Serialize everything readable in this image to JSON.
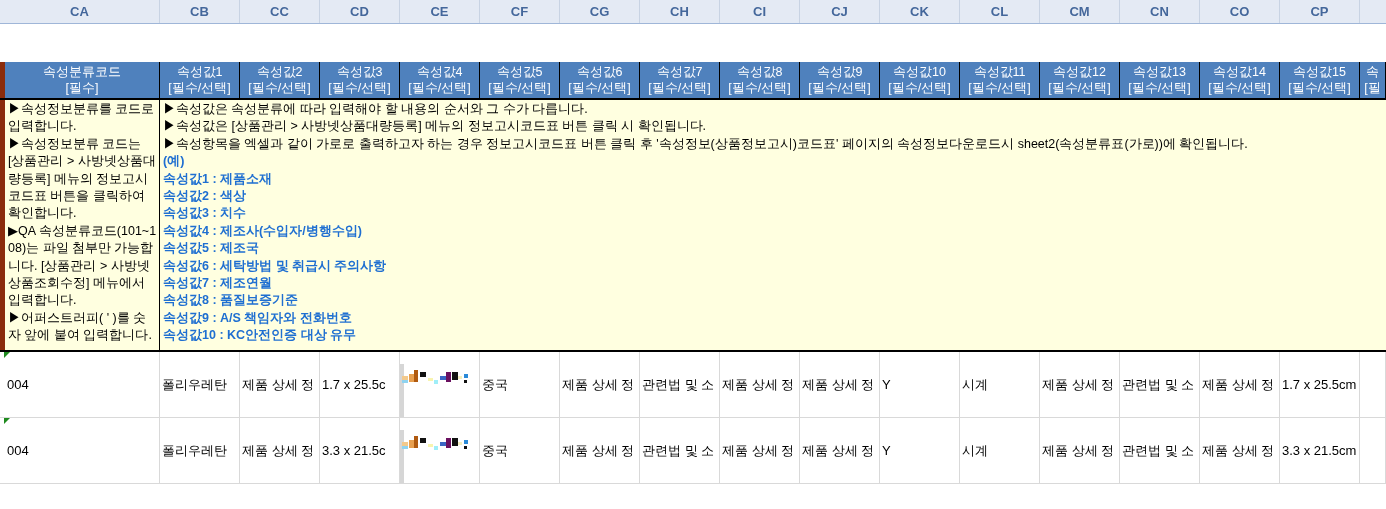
{
  "column_letters": [
    "CA",
    "CB",
    "CC",
    "CD",
    "CE",
    "CF",
    "CG",
    "CH",
    "CI",
    "CJ",
    "CK",
    "CL",
    "CM",
    "CN",
    "CO",
    "CP"
  ],
  "header": [
    {
      "title": "속성분류코드",
      "note": "[필수]"
    },
    {
      "title": "속성값1",
      "note": "[필수/선택]"
    },
    {
      "title": "속성값2",
      "note": "[필수/선택]"
    },
    {
      "title": "속성값3",
      "note": "[필수/선택]"
    },
    {
      "title": "속성값4",
      "note": "[필수/선택]"
    },
    {
      "title": "속성값5",
      "note": "[필수/선택]"
    },
    {
      "title": "속성값6",
      "note": "[필수/선택]"
    },
    {
      "title": "속성값7",
      "note": "[필수/선택]"
    },
    {
      "title": "속성값8",
      "note": "[필수/선택]"
    },
    {
      "title": "속성값9",
      "note": "[필수/선택]"
    },
    {
      "title": "속성값10",
      "note": "[필수/선택]"
    },
    {
      "title": "속성값11",
      "note": "[필수/선택]"
    },
    {
      "title": "속성값12",
      "note": "[필수/선택]"
    },
    {
      "title": "속성값13",
      "note": "[필수/선택]"
    },
    {
      "title": "속성값14",
      "note": "[필수/선택]"
    },
    {
      "title": "속성값15",
      "note": "[필수/선택]"
    },
    {
      "title": "속",
      "note": "[필"
    }
  ],
  "classification_note": [
    "▶속성정보분류를 코드로 입력합니다.",
    "▶속성정보분류 코드는 [상품관리 > 사방넷상품대량등록] 메뉴의 정보고시코드표 버튼을 클릭하여 확인합니다.",
    "▶QA 속성분류코드(101~108)는 파일 첨부만 가능합니다. [상품관리 > 사방넷상품조회수정] 메뉴에서 입력합니다.",
    "▶어퍼스트러피( ' )를 숫자 앞에 붙여 입력합니다."
  ],
  "attribute_note": {
    "lines": [
      "▶속성값은 속성분류에 따라 입력해야 할 내용의 순서와 그 수가 다릅니다.",
      "▶속성값은 [상품관리 > 사방넷상품대량등록] 메뉴의 정보고시코드표 버튼 클릭 시 확인됩니다.",
      "▶속성항목을 엑셀과 같이 가로로 출력하고자 하는 경우 정보고시코드표 버튼 클릭 후 '속성정보(상품정보고시)코드표' 페이지의 속성정보다운로드시 sheet2(속성분류표(가로))에 확인됩니다."
    ],
    "example_heading": "(예)",
    "examples": [
      "속성값1 : 제품소재",
      "속성값2 : 색상",
      "속성값3 : 치수",
      "속성값4 : 제조사(수입자/병행수입)",
      "속성값5 : 제조국",
      "속성값6 : 세탁방법 및 취급시 주의사항",
      "속성값7 : 제조연월",
      "속성값8 : 품질보증기준",
      "속성값9 : A/S 책임자와 전화번호",
      "속성값10 : KC안전인증 대상 유무"
    ]
  },
  "rows": [
    {
      "cells": [
        {
          "kind": "text",
          "text": "004"
        },
        {
          "kind": "text",
          "text": "폴리우레탄"
        },
        {
          "kind": "text",
          "text": "제품 상세 정"
        },
        {
          "kind": "text",
          "text": "1.7 x 25.5c"
        },
        {
          "kind": "picture"
        },
        {
          "kind": "text",
          "text": "중국"
        },
        {
          "kind": "text",
          "text": "제품 상세 정"
        },
        {
          "kind": "text",
          "text": "관련법 및 소"
        },
        {
          "kind": "text",
          "text": "제품 상세 정"
        },
        {
          "kind": "text",
          "text": "제품 상세 정"
        },
        {
          "kind": "text",
          "text": "Y"
        },
        {
          "kind": "text",
          "text": "시계"
        },
        {
          "kind": "text",
          "text": "제품 상세 정"
        },
        {
          "kind": "text",
          "text": "관련법 및 소"
        },
        {
          "kind": "text",
          "text": "제품 상세 정"
        },
        {
          "kind": "text",
          "text": "1.7 x 25.5cm"
        }
      ]
    },
    {
      "cells": [
        {
          "kind": "text",
          "text": "004"
        },
        {
          "kind": "text",
          "text": "폴리우레탄"
        },
        {
          "kind": "text",
          "text": "제품 상세 정"
        },
        {
          "kind": "text",
          "text": "3.3 x 21.5c"
        },
        {
          "kind": "picture"
        },
        {
          "kind": "text",
          "text": "중국"
        },
        {
          "kind": "text",
          "text": "제품 상세 정"
        },
        {
          "kind": "text",
          "text": "관련법 및 소"
        },
        {
          "kind": "text",
          "text": "제품 상세 정"
        },
        {
          "kind": "text",
          "text": "제품 상세 정"
        },
        {
          "kind": "text",
          "text": "Y"
        },
        {
          "kind": "text",
          "text": "시계"
        },
        {
          "kind": "text",
          "text": "제품 상세 정"
        },
        {
          "kind": "text",
          "text": "관련법 및 소"
        },
        {
          "kind": "text",
          "text": "제품 상세 정"
        },
        {
          "kind": "text",
          "text": "3.3 x 21.5cm"
        }
      ]
    }
  ]
}
